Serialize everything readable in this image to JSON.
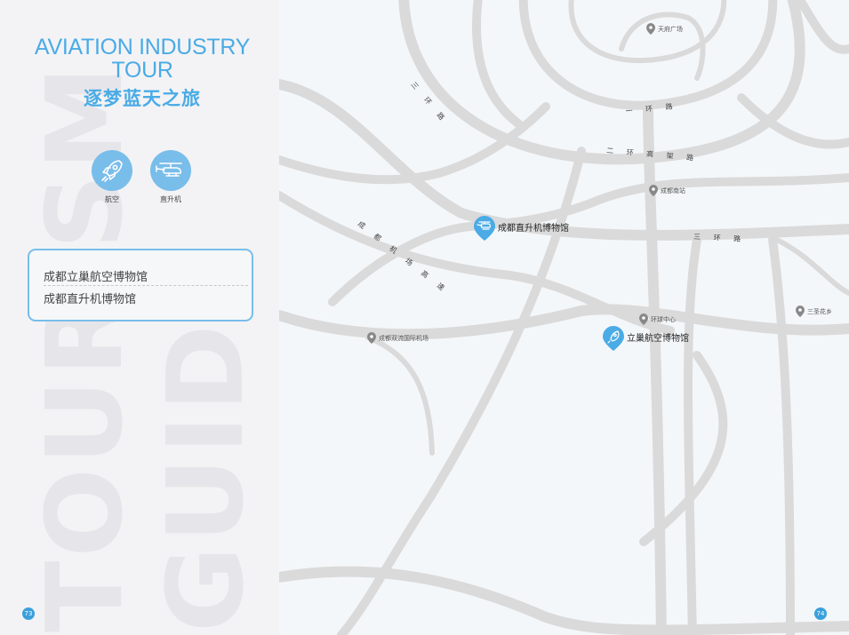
{
  "left_page": {
    "watermark_lines": [
      "TOURISM",
      "GUIDE"
    ],
    "title_en_line1": "AVIATION INDUSTRY",
    "title_en_line2": "TOUR",
    "title_zh": "逐梦蓝天之旅",
    "categories": [
      {
        "label": "航空",
        "icon": "rocket-icon"
      },
      {
        "label": "直升机",
        "icon": "helicopter-icon"
      }
    ],
    "list_items": [
      "成都立巢航空博物馆",
      "成都直升机博物馆"
    ],
    "page_number": "73"
  },
  "map": {
    "roads": {
      "ring1": "一 环 路",
      "ring2_elevated": "二 环 高 架 路",
      "ring3_west": "三 环 路",
      "ring3_east": "三 环 路",
      "airport_expressway": "成 都 机 场 高 速"
    },
    "pois": [
      {
        "name": "天府广场"
      },
      {
        "name": "成都南站"
      },
      {
        "name": "环球中心"
      },
      {
        "name": "三圣花乡"
      },
      {
        "name": "成都双流国际机场"
      }
    ],
    "museums": [
      {
        "name": "成都直升机博物馆",
        "icon": "helicopter-icon"
      },
      {
        "name": "立巢航空博物馆",
        "icon": "rocket-icon"
      }
    ],
    "colors": {
      "accent": "#4aabe6",
      "road": "#dadada",
      "background": "#f4f7fa",
      "pin": "#888888"
    }
  },
  "right_page": {
    "page_number": "74"
  }
}
